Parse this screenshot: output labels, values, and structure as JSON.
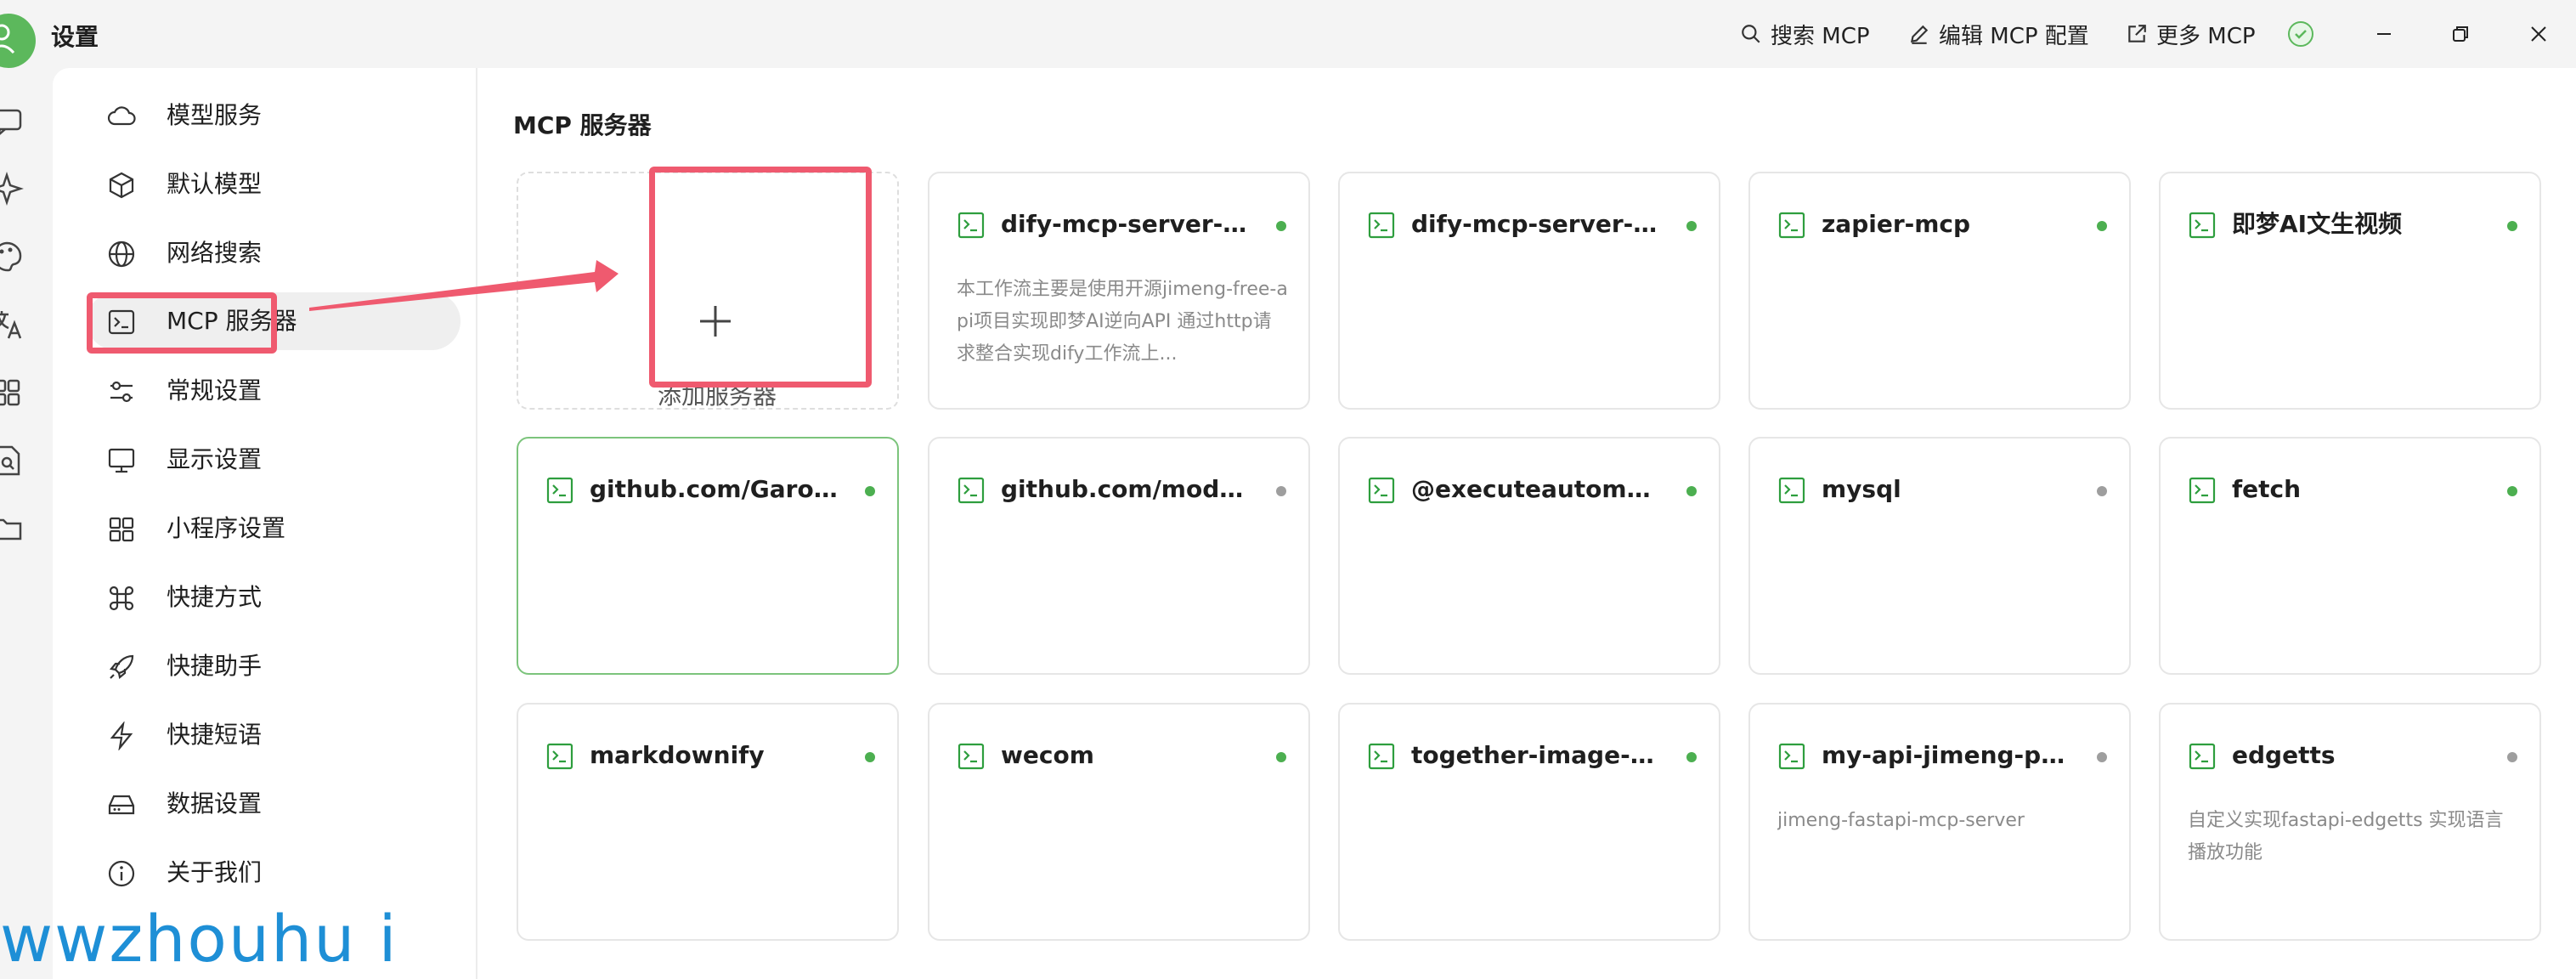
{
  "window": {
    "title": "设置",
    "actions": [
      {
        "label": "搜索 MCP",
        "icon": "search-icon"
      },
      {
        "label": "编辑 MCP 配置",
        "icon": "edit-icon"
      },
      {
        "label": "更多 MCP",
        "icon": "external-link-icon"
      }
    ],
    "status_icon": "check-circle-icon"
  },
  "rail_icons": [
    "chat-icon",
    "sparkle-icon",
    "palette-icon",
    "translate-icon",
    "apps-icon",
    "file-search-icon",
    "folder-icon"
  ],
  "sidebar": {
    "items": [
      {
        "label": "模型服务",
        "icon": "cloud-icon"
      },
      {
        "label": "默认模型",
        "icon": "cube-icon"
      },
      {
        "label": "网络搜索",
        "icon": "globe-icon"
      },
      {
        "label": "MCP 服务器",
        "icon": "terminal-icon",
        "active": true
      },
      {
        "label": "常规设置",
        "icon": "sliders-icon"
      },
      {
        "label": "显示设置",
        "icon": "monitor-icon"
      },
      {
        "label": "小程序设置",
        "icon": "grid-icon"
      },
      {
        "label": "快捷方式",
        "icon": "command-icon"
      },
      {
        "label": "快捷助手",
        "icon": "rocket-icon"
      },
      {
        "label": "快捷短语",
        "icon": "zap-icon"
      },
      {
        "label": "数据设置",
        "icon": "hard-drive-icon"
      },
      {
        "label": "关于我们",
        "icon": "info-icon"
      }
    ]
  },
  "main": {
    "section_title": "MCP 服务器",
    "add_label": "添加服务器",
    "servers": [
      {
        "name": "dify-mcp-server-即梦...",
        "active": true,
        "desc": "本工作流主要是使用开源jimeng-free-api项目实现即梦AI逆向API 通过http请求整合实现dify工作流上..."
      },
      {
        "name": "dify-mcp-server-儿童...",
        "active": true,
        "desc": ""
      },
      {
        "name": "zapier-mcp",
        "active": true,
        "desc": ""
      },
      {
        "name": "即梦AI文生视频",
        "active": true,
        "desc": ""
      },
      {
        "name": "github.com/Garoth/sl...",
        "active": true,
        "desc": "",
        "selected": true
      },
      {
        "name": "github.com/modelco...",
        "active": false,
        "desc": ""
      },
      {
        "name": "@executeautomation...",
        "active": true,
        "desc": ""
      },
      {
        "name": "mysql",
        "active": false,
        "desc": ""
      },
      {
        "name": "fetch",
        "active": true,
        "desc": ""
      },
      {
        "name": "markdownify",
        "active": true,
        "desc": ""
      },
      {
        "name": "wecom",
        "active": true,
        "desc": ""
      },
      {
        "name": "together-image-gen",
        "active": true,
        "desc": ""
      },
      {
        "name": "my-api-jimeng-proxy",
        "active": false,
        "desc": "jimeng-fastapi-mcp-server"
      },
      {
        "name": "edgetts",
        "active": false,
        "desc": "自定义实现fastapi-edgetts 实现语言播放功能"
      }
    ]
  },
  "watermark": "wwzhouhu i",
  "colors": {
    "accent_green": "#4caf50",
    "inactive_gray": "#9e9e9e",
    "highlight_red": "#ef5a6f",
    "watermark_blue": "#1e8fd6"
  }
}
